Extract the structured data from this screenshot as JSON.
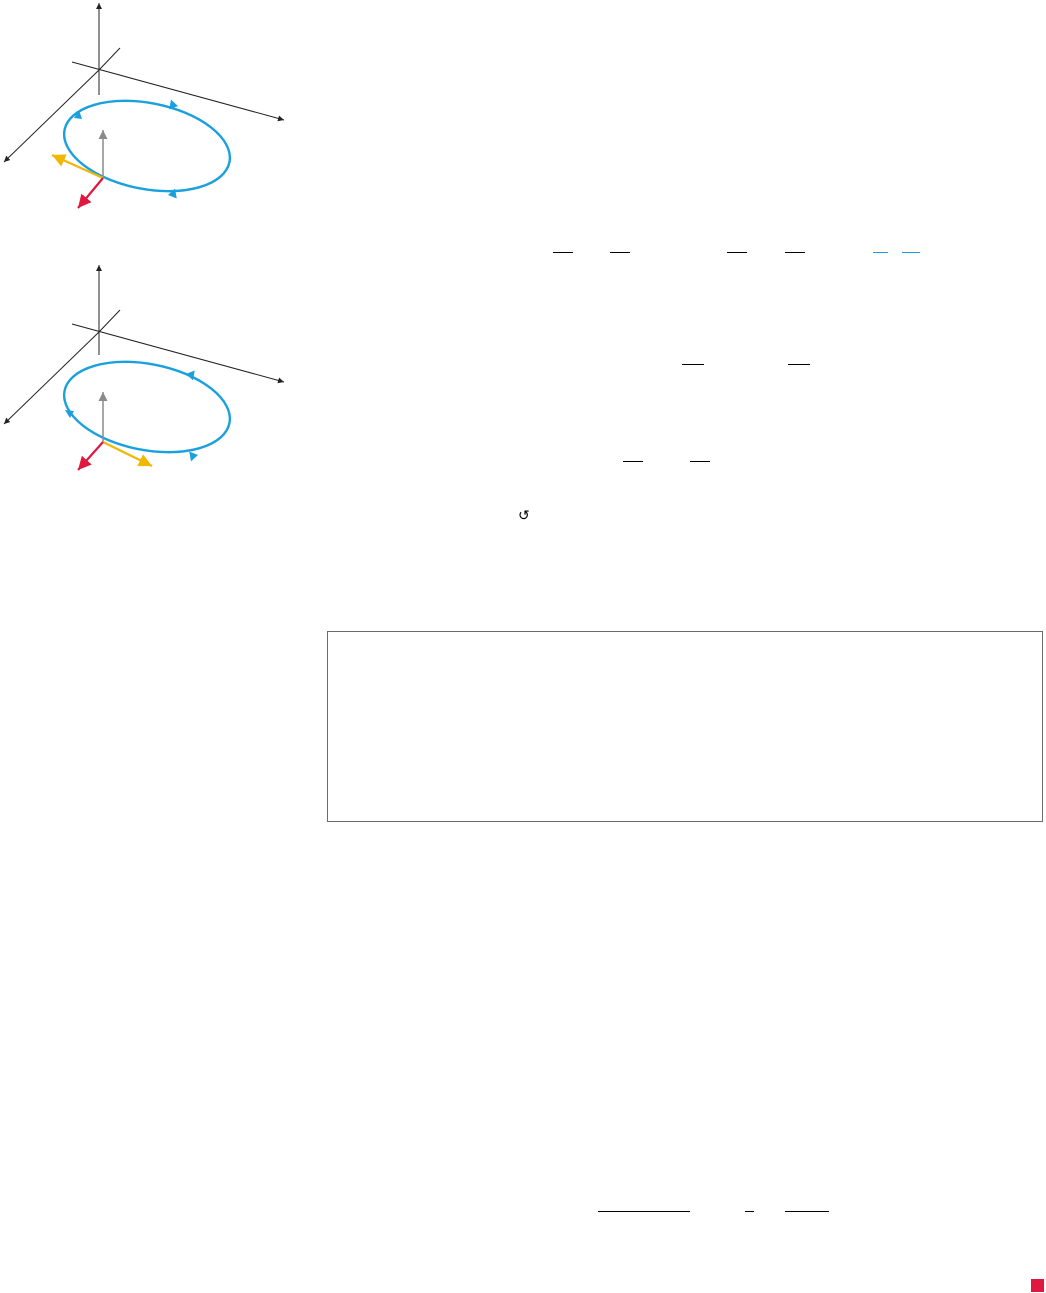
{
  "figures": [
    {
      "name": "figure-a-counterclockwise",
      "colors": {
        "axes": "#222222",
        "curve": "#1aa0dc",
        "tangent": "#f2b705",
        "normal": "#e0173f",
        "up_vector": "#8a8a8a"
      }
    },
    {
      "name": "figure-b-clockwise",
      "colors": {
        "axes": "#222222",
        "curve": "#1aa0dc",
        "tangent": "#f2b705",
        "normal": "#e0173f",
        "up_vector": "#8a8a8a"
      }
    }
  ],
  "equations": {
    "orientation_glyph": "↺"
  },
  "page": {
    "end_marker_color": "#e0173f",
    "theorem_box_border": "#6b6b6b"
  }
}
